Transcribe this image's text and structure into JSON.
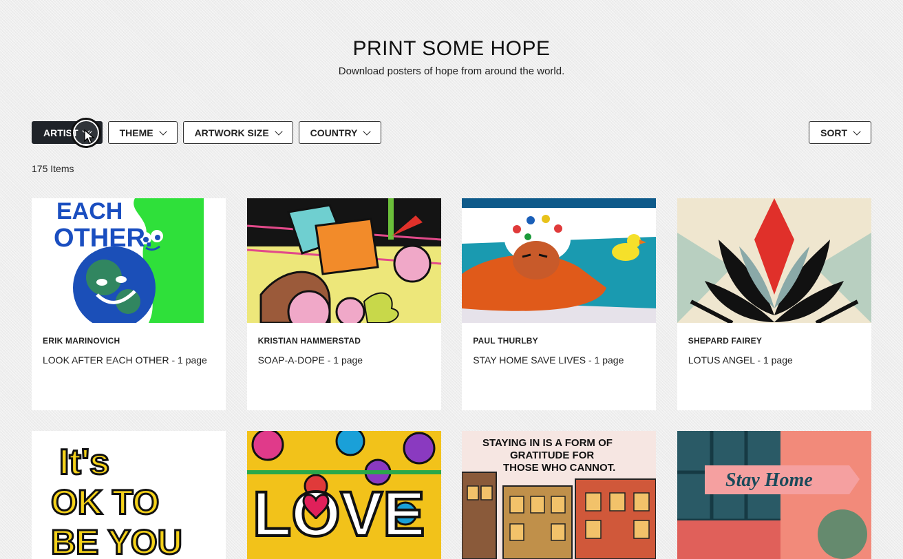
{
  "header": {
    "title": "PRINT SOME HOPE",
    "subtitle": "Download posters of hope from around the world."
  },
  "filters": [
    {
      "label": "ARTIST",
      "active": true
    },
    {
      "label": "THEME",
      "active": false
    },
    {
      "label": "ARTWORK SIZE",
      "active": false
    },
    {
      "label": "COUNTRY",
      "active": false
    }
  ],
  "sort": {
    "label": "SORT"
  },
  "results": {
    "count_text": "175 Items"
  },
  "cards": [
    {
      "artist": "ERIK MARINOVICH",
      "title": "LOOK AFTER EACH OTHER - 1 page",
      "art_text": [
        "EACH",
        "OTHER."
      ]
    },
    {
      "artist": "KRISTIAN HAMMERSTAD",
      "title": "SOAP-A-DOPE - 1 page"
    },
    {
      "artist": "PAUL THURLBY",
      "title": "STAY HOME SAVE LIVES - 1 page"
    },
    {
      "artist": "SHEPARD FAIREY",
      "title": "LOTUS ANGEL - 1 page"
    },
    {
      "artist": "",
      "title": "",
      "art_text": [
        "It's",
        "OK TO",
        "BE YOU"
      ]
    },
    {
      "artist": "",
      "title": "",
      "art_text": [
        "LOVE"
      ]
    },
    {
      "artist": "",
      "title": "",
      "art_text": [
        "STAYING IN IS A FORM OF",
        "GRATITUDE FOR",
        "THOSE WHO CANNOT."
      ]
    },
    {
      "artist": "",
      "title": "",
      "art_text": [
        "Stay Home"
      ]
    }
  ],
  "colors": {
    "active_filter_bg": "#1f2329",
    "card_bg": "#ffffff",
    "page_bg": "#eeeeee"
  }
}
